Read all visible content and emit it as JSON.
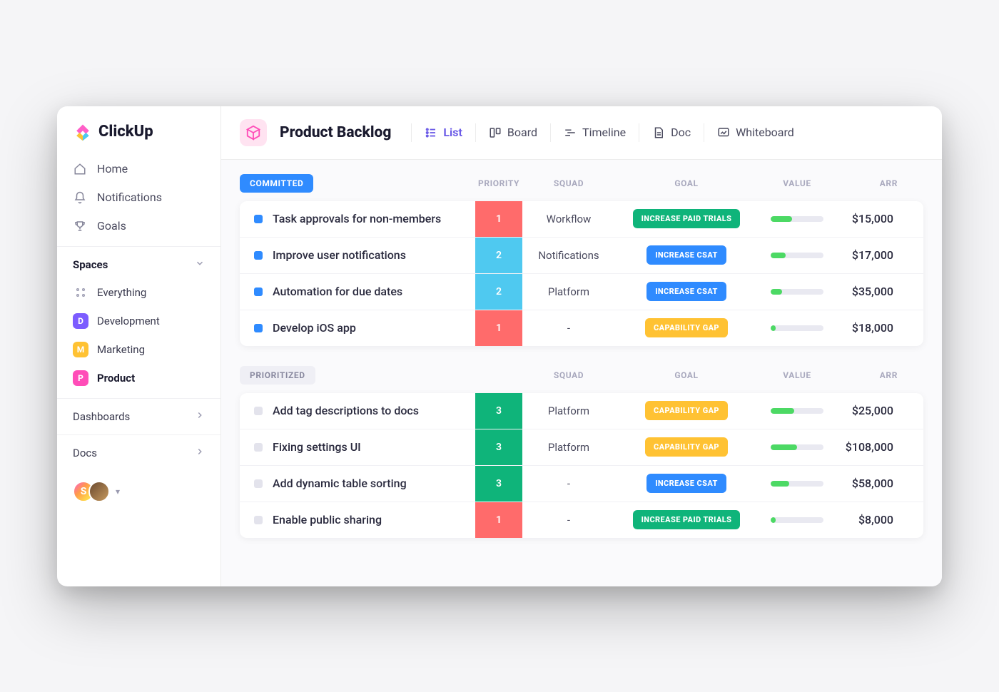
{
  "brand": {
    "name": "ClickUp"
  },
  "sidebar": {
    "nav": [
      {
        "label": "Home"
      },
      {
        "label": "Notifications"
      },
      {
        "label": "Goals"
      }
    ],
    "spaces_header": "Spaces",
    "everything_label": "Everything",
    "spaces": [
      {
        "initial": "D",
        "label": "Development",
        "bg": "#7c5cff",
        "active": false
      },
      {
        "initial": "M",
        "label": "Marketing",
        "bg": "#ffc233",
        "active": false
      },
      {
        "initial": "P",
        "label": "Product",
        "bg": "#ff4db8",
        "active": true
      }
    ],
    "dashboards_label": "Dashboards",
    "docs_label": "Docs",
    "avatar_initial": "S"
  },
  "header": {
    "title": "Product Backlog",
    "views": [
      {
        "label": "List",
        "active": true
      },
      {
        "label": "Board",
        "active": false
      },
      {
        "label": "Timeline",
        "active": false
      },
      {
        "label": "Doc",
        "active": false
      },
      {
        "label": "Whiteboard",
        "active": false
      }
    ]
  },
  "columns": {
    "priority": "PRIORITY",
    "squad": "SQUAD",
    "goal": "GOAL",
    "value": "VALUE",
    "arr": "ARR"
  },
  "goal_colors": {
    "INCREASE PAID TRIALS": "#0fb47a",
    "INCREASE CSAT": "#2f8bff",
    "CAPABILITY GAP": "#ffc233"
  },
  "priority_colors": {
    "1": "#ff6b6b",
    "2": "#4fc9f0",
    "3": "#0fb47a"
  },
  "groups": [
    {
      "name": "COMMITTED",
      "label_bg": "#2f8bff",
      "status_dot": "#2f8bff",
      "show_priority_header": true,
      "rows": [
        {
          "title": "Task approvals for non-members",
          "priority": "1",
          "squad": "Workflow",
          "goal": "INCREASE PAID TRIALS",
          "value_pct": 40,
          "arr": "$15,000"
        },
        {
          "title": "Improve  user notifications",
          "priority": "2",
          "squad": "Notifications",
          "goal": "INCREASE CSAT",
          "value_pct": 28,
          "arr": "$17,000"
        },
        {
          "title": "Automation for due dates",
          "priority": "2",
          "squad": "Platform",
          "goal": "INCREASE CSAT",
          "value_pct": 22,
          "arr": "$35,000"
        },
        {
          "title": "Develop iOS app",
          "priority": "1",
          "squad": "-",
          "goal": "CAPABILITY GAP",
          "value_pct": 10,
          "arr": "$18,000"
        }
      ]
    },
    {
      "name": "PRIORITIZED",
      "label_bg": "#efeff5",
      "label_fg": "#8a8aa0",
      "status_dot": "#e3e3ec",
      "show_priority_header": false,
      "rows": [
        {
          "title": "Add tag descriptions to docs",
          "priority": "3",
          "squad": "Platform",
          "goal": "CAPABILITY GAP",
          "value_pct": 45,
          "arr": "$25,000"
        },
        {
          "title": "Fixing settings UI",
          "priority": "3",
          "squad": "Platform",
          "goal": "CAPABILITY GAP",
          "value_pct": 50,
          "arr": "$108,000"
        },
        {
          "title": "Add dynamic table sorting",
          "priority": "3",
          "squad": "-",
          "goal": "INCREASE CSAT",
          "value_pct": 35,
          "arr": "$58,000"
        },
        {
          "title": "Enable public sharing",
          "priority": "1",
          "squad": "-",
          "goal": "INCREASE PAID TRIALS",
          "value_pct": 10,
          "arr": "$8,000"
        }
      ]
    }
  ]
}
